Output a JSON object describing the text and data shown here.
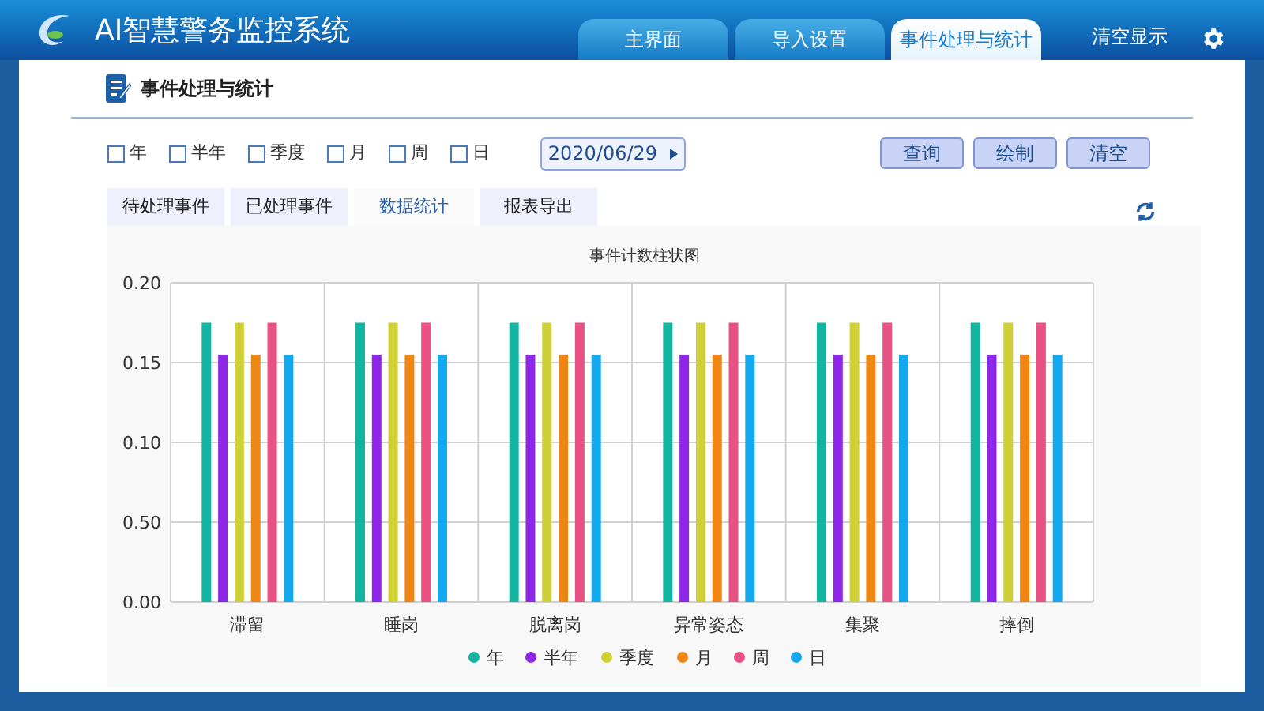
{
  "header": {
    "title": "AI智慧警务监控系统",
    "tabs": [
      {
        "label": "主界面",
        "selected": false
      },
      {
        "label": "导入设置",
        "selected": false
      },
      {
        "label": "事件处理与统计",
        "selected": true
      }
    ],
    "clear_button": "清空显示"
  },
  "section": {
    "title": "事件处理与统计"
  },
  "filters": [
    {
      "label": "年",
      "checked": false
    },
    {
      "label": "半年",
      "checked": false
    },
    {
      "label": "季度",
      "checked": false
    },
    {
      "label": "月",
      "checked": false
    },
    {
      "label": "周",
      "checked": false
    },
    {
      "label": "日",
      "checked": false
    }
  ],
  "date": "2020/06/29",
  "actions": [
    "查询",
    "绘制",
    "清空"
  ],
  "sub_tabs": [
    {
      "label": "待处理事件",
      "selected": false
    },
    {
      "label": "已处理事件",
      "selected": false
    },
    {
      "label": "数据统计",
      "selected": true
    },
    {
      "label": "报表导出",
      "selected": false
    }
  ],
  "chart": {
    "y_midtick_label": "0.50",
    "chart_data": {
      "type": "bar",
      "title": "事件计数柱状图",
      "categories": [
        "滞留",
        "睡岗",
        "脱离岗",
        "异常姿态",
        "集聚",
        "摔倒"
      ],
      "ylim": [
        0,
        0.2
      ],
      "grid": true,
      "legend": true,
      "yticks": [
        {
          "value": 0,
          "label": "0.00"
        },
        {
          "value": 0.1,
          "label": "0.10"
        },
        0.15,
        {
          "value": 0.2,
          "label": "0.20"
        }
      ],
      "series": [
        {
          "name": "年",
          "color": "#13b5a0",
          "values": [
            0.175,
            0.175,
            0.175,
            0.175,
            0.175,
            0.175
          ]
        },
        {
          "name": "半年",
          "color": "#8f27e8",
          "values": [
            0.155,
            0.155,
            0.155,
            0.155,
            0.155,
            0.155
          ]
        },
        {
          "name": "季度",
          "color": "#cfcf37",
          "values": [
            0.175,
            0.175,
            0.175,
            0.175,
            0.175,
            0.175
          ]
        },
        {
          "name": "月",
          "color": "#ef8614",
          "values": [
            0.155,
            0.155,
            0.155,
            0.155,
            0.155,
            0.155
          ]
        },
        {
          "name": "周",
          "color": "#e95183",
          "values": [
            0.175,
            0.175,
            0.175,
            0.175,
            0.175,
            0.175
          ]
        },
        {
          "name": "日",
          "color": "#14a8ee",
          "values": [
            0.155,
            0.155,
            0.155,
            0.155,
            0.155,
            0.155
          ]
        }
      ]
    }
  }
}
